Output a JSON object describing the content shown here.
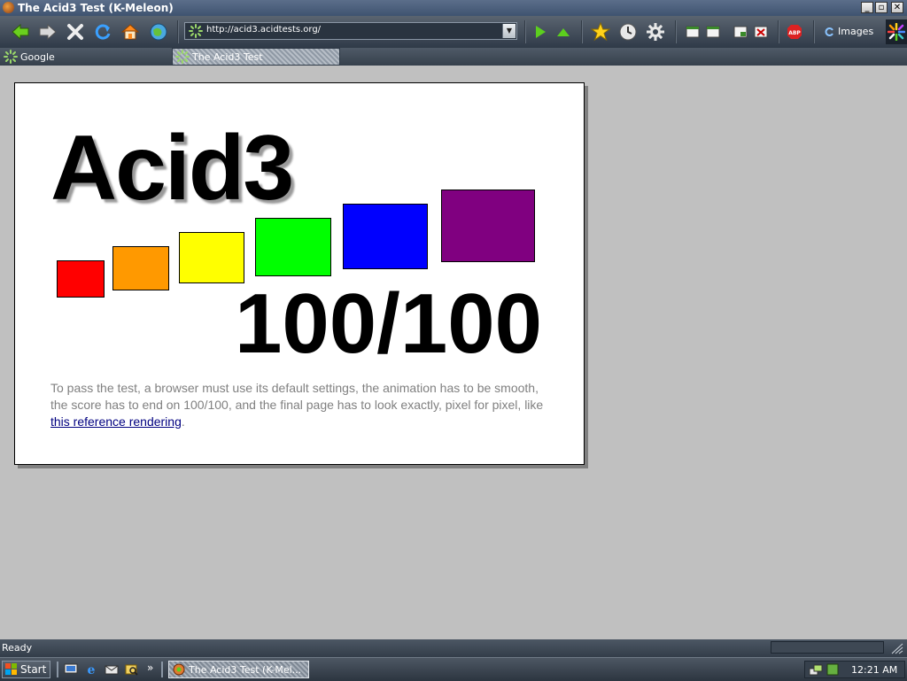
{
  "window": {
    "title": "The Acid3 Test (K-Meleon)",
    "controls": [
      "_",
      "▫",
      "✕"
    ]
  },
  "toolbar": {
    "url": "http://acid3.acidtests.org/",
    "images_label": "Images",
    "buttons": [
      "back",
      "forward",
      "stop",
      "reload",
      "home",
      "search"
    ]
  },
  "tabs": [
    {
      "label": "Google"
    },
    {
      "label": "The Acid3 Test",
      "active": true
    }
  ],
  "page": {
    "title": "Acid3",
    "score": "100/100",
    "description_text": "To pass the test, a browser must use its default settings, the animation has to be smooth, the score has to end on 100/100, and the final page has to look exactly, pixel for pixel, like ",
    "link_text": "this reference rendering",
    "period": ".",
    "boxes": [
      {
        "color": "#ff0000"
      },
      {
        "color": "#ff9900"
      },
      {
        "color": "#ffff00"
      },
      {
        "color": "#00ff00"
      },
      {
        "color": "#0000ff"
      },
      {
        "color": "#800080"
      }
    ]
  },
  "status": {
    "text": "Ready"
  },
  "taskbar": {
    "start_label": "Start",
    "task_label": "The Acid3 Test (K-Mel...",
    "clock": "12:21 AM"
  },
  "colors": {
    "toolbar_dark": "#2f3a48",
    "content_bg": "#c0c0c0",
    "description_gray": "#808080",
    "link_blue": "#000080"
  }
}
